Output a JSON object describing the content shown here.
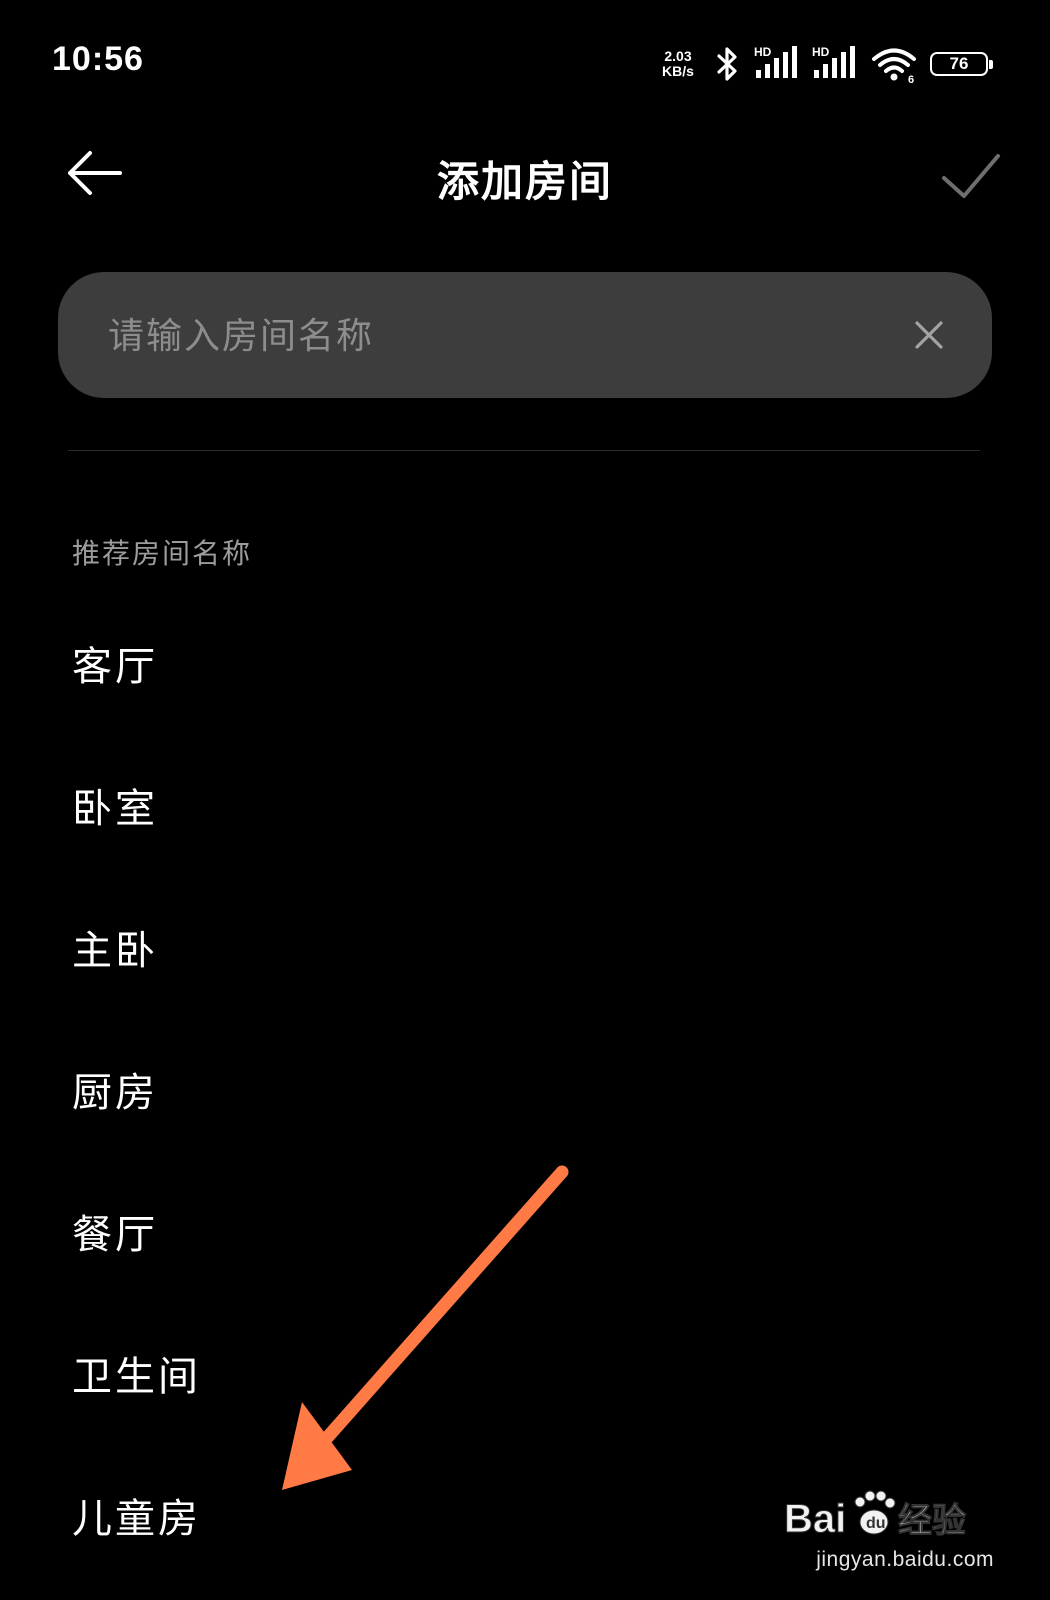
{
  "status_bar": {
    "time": "10:56",
    "net_speed_value": "2.03",
    "net_speed_unit": "KB/s",
    "hd_label_1": "HD",
    "hd_label_2": "HD",
    "wifi_badge": "6",
    "battery": "76",
    "icons": [
      "bluetooth-icon",
      "signal-icon",
      "signal-icon",
      "wifi-icon",
      "battery-icon"
    ]
  },
  "header": {
    "title": "添加房间",
    "back_icon": "arrow-left-icon",
    "confirm_icon": "checkmark-icon"
  },
  "search": {
    "placeholder": "请输入房间名称",
    "value": "",
    "clear_icon": "close-icon"
  },
  "suggestions": {
    "label": "推荐房间名称",
    "items": [
      "客厅",
      "卧室",
      "主卧",
      "厨房",
      "餐厅",
      "卫生间",
      "儿童房"
    ]
  },
  "annotation": {
    "color": "#ff7a45"
  },
  "watermark": {
    "brand": "Baidu经验",
    "url": "jingyan.baidu.com"
  },
  "colors": {
    "background": "#000000",
    "input_bg": "#3d3d3d",
    "placeholder": "#8d8d8d",
    "section_label": "#9c9c9c",
    "arrow": "#ff7a45"
  }
}
